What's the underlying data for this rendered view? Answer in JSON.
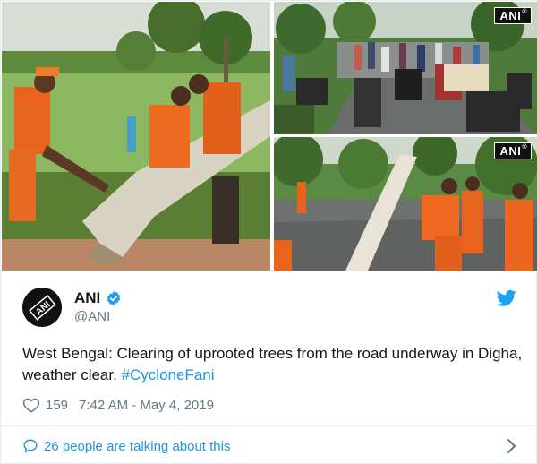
{
  "media": {
    "watermark": "ANI",
    "watermark_mark": "®"
  },
  "author": {
    "name": "ANI",
    "handle": "@ANI",
    "avatar_text": "ANI",
    "verified": true
  },
  "tweet": {
    "text_main": "West Bengal: Clearing of uprooted trees from the road underway in Digha, weather clear. ",
    "hashtag": "#CycloneFani"
  },
  "meta": {
    "likes": "159",
    "timestamp": "7:42 AM - May 4, 2019"
  },
  "footer": {
    "conversation_label": "26 people are talking about this"
  },
  "colors": {
    "link": "#1b95e0",
    "secondary_text": "#657786",
    "primary_text": "#14171a",
    "border": "#e6ecf0"
  },
  "icons": {
    "verified": "verified-badge-icon",
    "twitter": "twitter-bird-icon",
    "like": "heart-icon",
    "conversation": "speech-bubble-icon",
    "expand": "chevron-right-icon"
  }
}
